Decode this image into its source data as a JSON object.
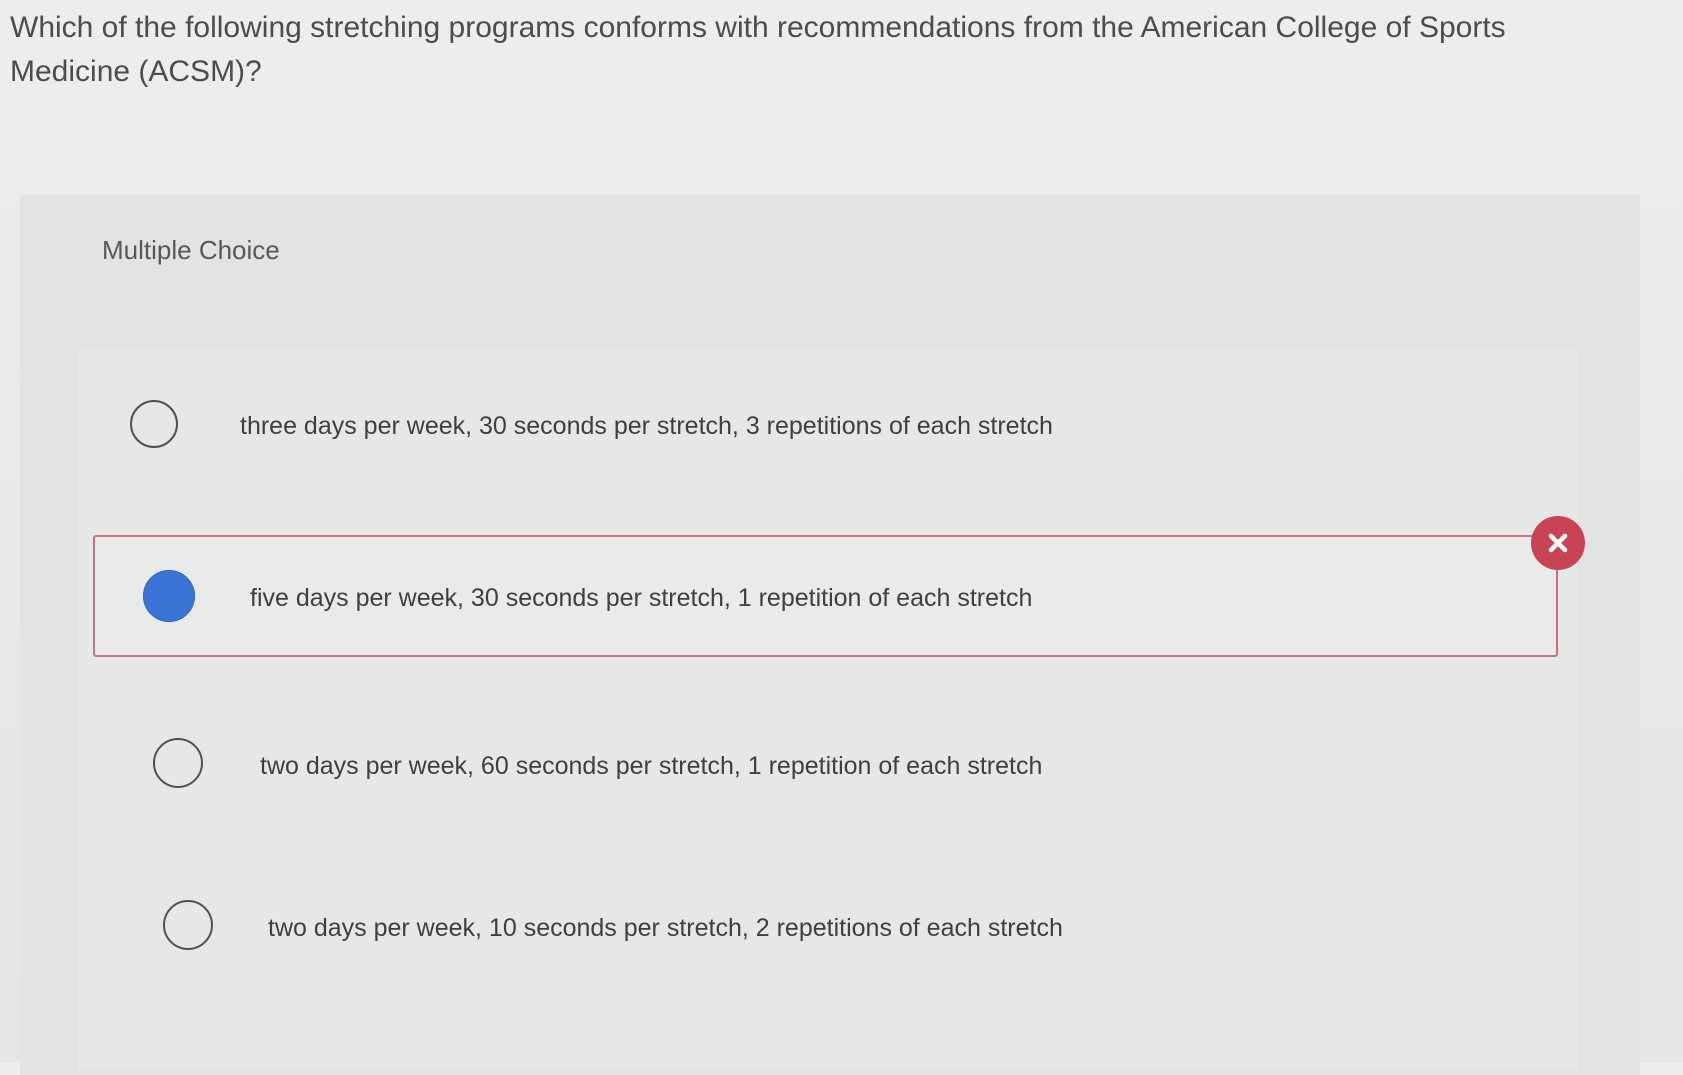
{
  "question": {
    "text": "Which of the following stretching programs conforms with recommendations from the American College of Sports Medicine (ACSM)?"
  },
  "section": {
    "heading": "Multiple Choice"
  },
  "options": [
    {
      "label": "three days per week, 30 seconds per stretch, 3 repetitions of each stretch",
      "selected": false,
      "marked_incorrect": false
    },
    {
      "label": "five days per week, 30 seconds per stretch, 1 repetition of each stretch",
      "selected": true,
      "marked_incorrect": true
    },
    {
      "label": "two days per week, 60 seconds per stretch, 1 repetition of each stretch",
      "selected": false,
      "marked_incorrect": false
    },
    {
      "label": "two days per week, 10 seconds per stretch, 2 repetitions of each stretch",
      "selected": false,
      "marked_incorrect": false
    }
  ],
  "icons": {
    "incorrect_badge": "close-x-icon"
  },
  "colors": {
    "selected_radio": "#3b74d6",
    "incorrect_border": "#c9727c",
    "incorrect_badge": "#c84455"
  }
}
